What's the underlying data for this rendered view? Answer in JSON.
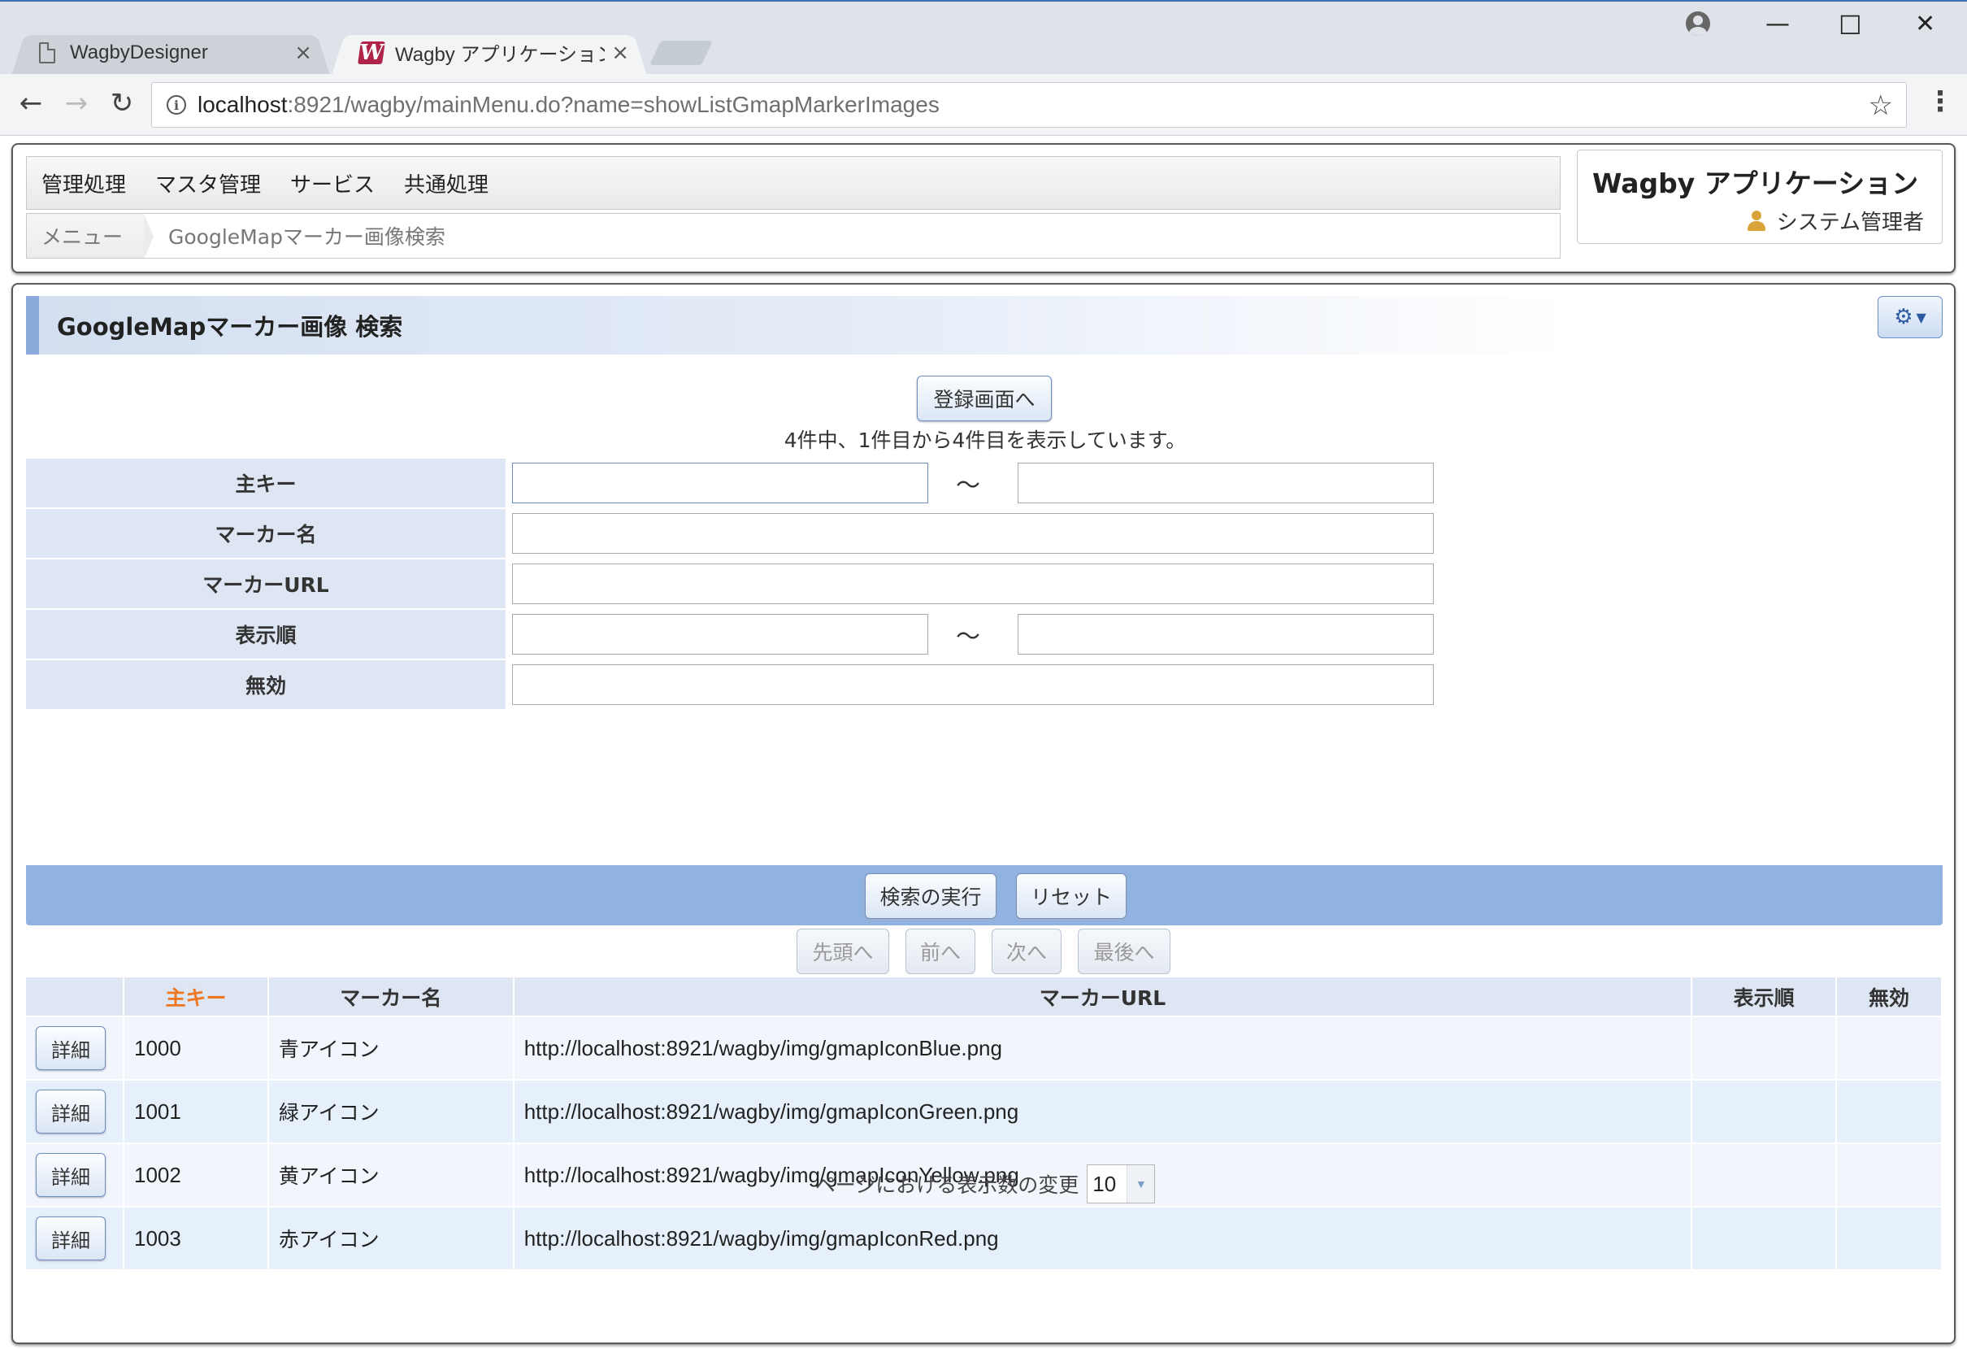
{
  "browser": {
    "tabs": [
      {
        "title": "WagbyDesigner",
        "close": "×",
        "icon": "page-icon"
      },
      {
        "title": "Wagby アプリケーション Goo",
        "close": "×",
        "icon": "wagby-logo-icon"
      }
    ],
    "url_host": "localhost",
    "url_rest": ":8921/wagby/mainMenu.do?name=showListGmapMarkerImages",
    "window_controls": {
      "minimize": "—",
      "maximize": "☐",
      "close": "✕"
    },
    "nav": {
      "back": "←",
      "forward": "→",
      "reload": "↻",
      "star": "☆",
      "menu": "⋮"
    },
    "favicon_letter": "W"
  },
  "header": {
    "menu": [
      "管理処理",
      "マスタ管理",
      "サービス",
      "共通処理"
    ],
    "breadcrumb": {
      "home": "メニュー",
      "current": "GoogleMapマーカー画像検索"
    },
    "app_title": "Wagby アプリケーション",
    "user": "システム管理者"
  },
  "main": {
    "heading": "GoogleMapマーカー画像 検索",
    "gear_icon": "⚙",
    "gear_caret": "▼",
    "register_button": "登録画面へ",
    "count_message": "4件中、1件目から4件目を表示しています。",
    "search_fields": [
      {
        "label": "主キー",
        "range": true
      },
      {
        "label": "マーカー名",
        "range": false
      },
      {
        "label": "マーカーURL",
        "range": false
      },
      {
        "label": "表示順",
        "range": true
      },
      {
        "label": "無効",
        "range": false
      }
    ],
    "range_separator": "～",
    "exec_button": "検索の実行",
    "reset_button": "リセット",
    "pager": {
      "first": "先頭へ",
      "prev": "前へ",
      "next": "次へ",
      "last": "最後へ"
    },
    "table": {
      "columns": [
        "",
        "主キー",
        "マーカー名",
        "マーカーURL",
        "表示順",
        "無効"
      ],
      "detail_label": "詳細",
      "rows": [
        {
          "id": "1000",
          "name": "青アイコン",
          "url": "http://localhost:8921/wagby/img/gmapIconBlue.png",
          "order": "",
          "disabled": ""
        },
        {
          "id": "1001",
          "name": "緑アイコン",
          "url": "http://localhost:8921/wagby/img/gmapIconGreen.png",
          "order": "",
          "disabled": ""
        },
        {
          "id": "1002",
          "name": "黄アイコン",
          "url": "http://localhost:8921/wagby/img/gmapIconYellow.png",
          "order": "",
          "disabled": ""
        },
        {
          "id": "1003",
          "name": "赤アイコン",
          "url": "http://localhost:8921/wagby/img/gmapIconRed.png",
          "order": "",
          "disabled": ""
        }
      ]
    },
    "page_size_label": "ページにおける表示数の変更",
    "page_size_value": "10"
  },
  "colors": {
    "accent": "#8aabdb",
    "action_bar": "#91b3e1",
    "sorted_column": "#ee7722",
    "label_bg": "#dde6f2"
  }
}
